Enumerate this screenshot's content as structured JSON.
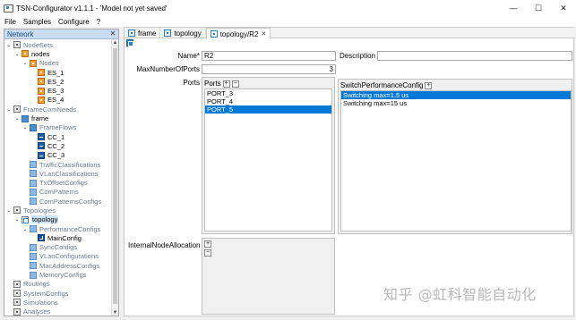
{
  "window": {
    "title": "TSN-Configurator v1.1.1 - 'Model not yet saved'",
    "controls": {
      "minimize": "—",
      "maximize": "☐",
      "close": "✕"
    }
  },
  "menu": [
    "File",
    "Samples",
    "Configure",
    "?"
  ],
  "navigator": {
    "title": "Network",
    "close": "✕",
    "tree": [
      {
        "label": "NodeSets",
        "toggle": "⌄",
        "icon": "set",
        "indent": 0,
        "muted": true
      },
      {
        "label": "nodes",
        "toggle": "⌄",
        "icon": "node",
        "indent": 1
      },
      {
        "label": "Nodes",
        "toggle": "⌄",
        "icon": "node",
        "indent": 2,
        "muted": true
      },
      {
        "label": "ES_1",
        "toggle": "",
        "icon": "es",
        "indent": 3
      },
      {
        "label": "ES_2",
        "toggle": "",
        "icon": "es",
        "indent": 3
      },
      {
        "label": "ES_3",
        "toggle": "",
        "icon": "es",
        "indent": 3
      },
      {
        "label": "ES_4",
        "toggle": "",
        "icon": "es",
        "indent": 3
      },
      {
        "label": "FrameComNeeds",
        "toggle": "⌄",
        "icon": "set",
        "indent": 0,
        "muted": true
      },
      {
        "label": "frame",
        "toggle": "⌄",
        "icon": "frame",
        "indent": 1
      },
      {
        "label": "FrameFlows",
        "toggle": "⌄",
        "icon": "frame",
        "indent": 2,
        "muted": true
      },
      {
        "label": "CC_1",
        "toggle": "",
        "icon": "flow",
        "indent": 3
      },
      {
        "label": "CC_2",
        "toggle": "",
        "icon": "flow",
        "indent": 3
      },
      {
        "label": "CC_3",
        "toggle": "",
        "icon": "flow",
        "indent": 3
      },
      {
        "label": "TrafficClassifications",
        "toggle": "",
        "icon": "cfg",
        "indent": 2,
        "muted": true
      },
      {
        "label": "VLanClassifications",
        "toggle": "",
        "icon": "cfg",
        "indent": 2,
        "muted": true
      },
      {
        "label": "TxOffsetConfigs",
        "toggle": "",
        "icon": "cfg",
        "indent": 2,
        "muted": true
      },
      {
        "label": "ComPatterns",
        "toggle": "",
        "icon": "cfg",
        "indent": 2,
        "muted": true
      },
      {
        "label": "ComPatternsConfigs",
        "toggle": "",
        "icon": "cfg",
        "indent": 2,
        "muted": true
      },
      {
        "label": "Topologies",
        "toggle": "⌄",
        "icon": "set",
        "indent": 0,
        "muted": true
      },
      {
        "label": "topology",
        "toggle": "⌄",
        "icon": "topo",
        "indent": 1,
        "selected": true
      },
      {
        "label": "PerformanceConfigs",
        "toggle": "⌄",
        "icon": "cfg",
        "indent": 2,
        "muted": true
      },
      {
        "label": "MainConfig",
        "toggle": "",
        "icon": "main",
        "indent": 3
      },
      {
        "label": "SyncConfigs",
        "toggle": "",
        "icon": "cfg",
        "indent": 2,
        "muted": true
      },
      {
        "label": "VLanConfigurations",
        "toggle": "",
        "icon": "cfg",
        "indent": 2,
        "muted": true
      },
      {
        "label": "MacAddressConfigs",
        "toggle": "",
        "icon": "cfg",
        "indent": 2,
        "muted": true
      },
      {
        "label": "MemoryConfigs",
        "toggle": "",
        "icon": "cfg",
        "indent": 2,
        "muted": true
      },
      {
        "label": "Routings",
        "toggle": "",
        "icon": "set",
        "indent": 0,
        "muted": true
      },
      {
        "label": "SystemConfigs",
        "toggle": "",
        "icon": "set",
        "indent": 0,
        "muted": true
      },
      {
        "label": "Simulations",
        "toggle": "",
        "icon": "set",
        "indent": 0,
        "muted": true
      },
      {
        "label": "Analyses",
        "toggle": "",
        "icon": "set",
        "indent": 0,
        "muted": true
      }
    ]
  },
  "tabs": [
    {
      "label": "frame",
      "active": false
    },
    {
      "label": "topology",
      "active": false
    },
    {
      "label": "topology/R2",
      "active": true,
      "close": "✕"
    }
  ],
  "form": {
    "name_label": "Name*",
    "name_value": "R2",
    "description_label": "Description",
    "description_value": "",
    "max_ports_label": "MaxNumberOfPorts",
    "max_ports_value": "3",
    "ports_label": "Ports",
    "ports_box_title": "Ports",
    "ports": [
      "PORT_3",
      "PORT_4",
      "PORT_5"
    ],
    "ports_selected_index": 2,
    "switch_box_title": "SwitchPerformanceConfig",
    "switch_items": [
      "Switching max=1.5 us",
      "Switching max=15 us"
    ],
    "switch_selected_index": 0,
    "internal_label": "InternalNodeAllocation",
    "add": "+",
    "remove": "−"
  },
  "watermark": "知乎 @虹科智能自动化",
  "colors": {
    "selection": "#0078d7",
    "nav_header": "#c9dbef"
  }
}
